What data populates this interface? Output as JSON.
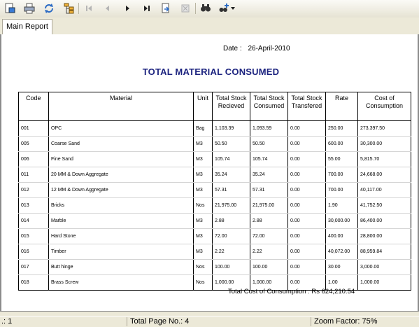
{
  "tabs": [
    {
      "label": "Main Report"
    }
  ],
  "report": {
    "date_label": "Date :",
    "date_value": "26-April-2010",
    "title": "TOTAL MATERIAL CONSUMED",
    "columns": {
      "code": "Code",
      "material": "Material",
      "unit": "Unit",
      "received": "Total Stock Recieved",
      "consumed": "Total Stock Consumed",
      "transfered": "Total Stock Transfered",
      "rate": "Rate",
      "cost": "Cost of Consumption"
    },
    "rows": [
      {
        "code": "001",
        "material": "OPC",
        "unit": "Bag",
        "received": "1,103.39",
        "consumed": "1,093.59",
        "transfered": "0.00",
        "rate": "250.00",
        "cost": "273,397.50"
      },
      {
        "code": "005",
        "material": "Coarse Sand",
        "unit": "M3",
        "received": "50.50",
        "consumed": "50.50",
        "transfered": "0.00",
        "rate": "600.00",
        "cost": "30,300.00"
      },
      {
        "code": "006",
        "material": "Fine Sand",
        "unit": "M3",
        "received": "105.74",
        "consumed": "105.74",
        "transfered": "0.00",
        "rate": "55.00",
        "cost": "5,815.70"
      },
      {
        "code": "011",
        "material": "20 MM & Down Aggregate",
        "unit": "M3",
        "received": "35.24",
        "consumed": "35.24",
        "transfered": "0.00",
        "rate": "700.00",
        "cost": "24,668.00"
      },
      {
        "code": "012",
        "material": "12 MM & Down Aggregate",
        "unit": "M3",
        "received": "57.31",
        "consumed": "57.31",
        "transfered": "0.00",
        "rate": "700.00",
        "cost": "40,117.00"
      },
      {
        "code": "013",
        "material": "Bricks",
        "unit": "Nos",
        "received": "21,975.00",
        "consumed": "21,975.00",
        "transfered": "0.00",
        "rate": "1.90",
        "cost": "41,752.50"
      },
      {
        "code": "014",
        "material": "Marble",
        "unit": "M3",
        "received": "2.88",
        "consumed": "2.88",
        "transfered": "0.00",
        "rate": "30,000.00",
        "cost": "86,400.00"
      },
      {
        "code": "015",
        "material": "Hard Stone",
        "unit": "M3",
        "received": "72.00",
        "consumed": "72.00",
        "transfered": "0.00",
        "rate": "400.00",
        "cost": "28,800.00"
      },
      {
        "code": "016",
        "material": "Timber",
        "unit": "M3",
        "received": "2.22",
        "consumed": "2.22",
        "transfered": "0.00",
        "rate": "40,072.00",
        "cost": "88,959.84"
      },
      {
        "code": "017",
        "material": "Butt hinge",
        "unit": "Nos",
        "received": "100.00",
        "consumed": "100.00",
        "transfered": "0.00",
        "rate": "30.00",
        "cost": "3,000.00"
      },
      {
        "code": "018",
        "material": "Brass Screw",
        "unit": "Nos",
        "received": "1,000.00",
        "consumed": "1,000.00",
        "transfered": "0.00",
        "rate": "1.00",
        "cost": "1,000.00"
      }
    ],
    "total_line": "Total Cost of Consumption : Rs 624,210.54"
  },
  "status": {
    "page_current": ".: 1",
    "total_pages": "Total Page No.: 4",
    "zoom": "Zoom Factor: 75%"
  },
  "colors": {
    "title": "#1c237f",
    "toolbar_icon": "#3a5fa8"
  },
  "icons": [
    "export-icon",
    "print-icon",
    "refresh-icon",
    "group-tree-icon",
    "first-page-icon",
    "prev-page-icon",
    "next-page-icon",
    "last-page-icon",
    "goto-page-icon",
    "close-view-icon",
    "search-icon",
    "zoom-icon",
    "dropdown-arrow-icon"
  ]
}
